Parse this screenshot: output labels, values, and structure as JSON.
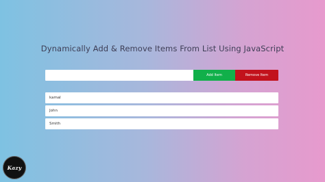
{
  "page": {
    "title": "Dynamically Add & Remove Items From List Using JavaScript"
  },
  "form": {
    "input_value": "",
    "add_label": "Add Item",
    "remove_label": "Remove Item"
  },
  "items": [
    {
      "label": "kamal"
    },
    {
      "label": "John"
    },
    {
      "label": "Smith"
    }
  ],
  "logo": {
    "text": "Kazy"
  },
  "colors": {
    "add_button": "#11b04a",
    "remove_button": "#c2121c",
    "gradient_left": "#7ec2e2",
    "gradient_right": "#e79acd"
  }
}
